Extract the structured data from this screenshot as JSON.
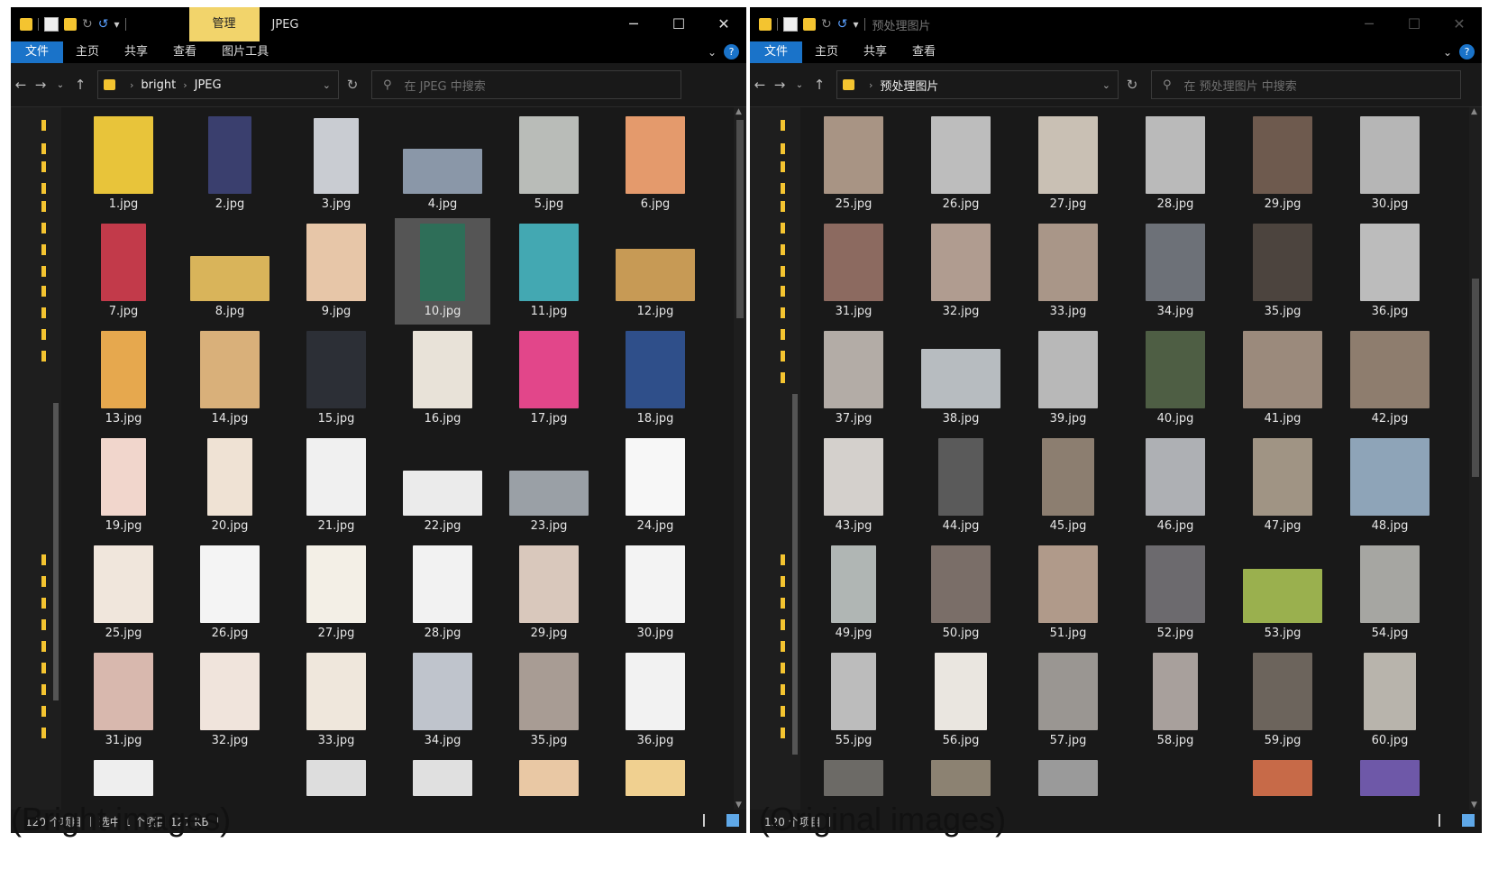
{
  "left_window": {
    "ribbon_context_tab": "管理",
    "title": "JPEG",
    "tabs": [
      "文件",
      "主页",
      "共享",
      "查看",
      "图片工具"
    ],
    "breadcrumb": [
      "bright",
      "JPEG"
    ],
    "search_placeholder": "在 JPEG 中搜索",
    "selected_item": "10.jpg",
    "status": {
      "count": "120 个项目",
      "selection": "选中 1 个项目  127 KB"
    },
    "files": [
      {
        "name": "1.jpg",
        "color": "#e8c43a",
        "w": 66,
        "h": 86
      },
      {
        "name": "2.jpg",
        "color": "#3a3f6e",
        "w": 48,
        "h": 86
      },
      {
        "name": "3.jpg",
        "color": "#c9ccd2",
        "w": 50,
        "h": 84
      },
      {
        "name": "4.jpg",
        "color": "#8a97a8",
        "w": 88,
        "h": 50
      },
      {
        "name": "5.jpg",
        "color": "#b9bcb8",
        "w": 66,
        "h": 86
      },
      {
        "name": "6.jpg",
        "color": "#e49a6c",
        "w": 66,
        "h": 86
      },
      {
        "name": "7.jpg",
        "color": "#c23a4a",
        "w": 50,
        "h": 86
      },
      {
        "name": "8.jpg",
        "color": "#d9b45a",
        "w": 88,
        "h": 50
      },
      {
        "name": "9.jpg",
        "color": "#e7c6a8",
        "w": 66,
        "h": 86
      },
      {
        "name": "10.jpg",
        "color": "#2e6e58",
        "w": 50,
        "h": 86
      },
      {
        "name": "11.jpg",
        "color": "#43a8b2",
        "w": 66,
        "h": 86
      },
      {
        "name": "12.jpg",
        "color": "#c79a55",
        "w": 88,
        "h": 58
      },
      {
        "name": "13.jpg",
        "color": "#e6a84e",
        "w": 50,
        "h": 86
      },
      {
        "name": "14.jpg",
        "color": "#d9b07a",
        "w": 66,
        "h": 86
      },
      {
        "name": "15.jpg",
        "color": "#2c2f36",
        "w": 66,
        "h": 86
      },
      {
        "name": "16.jpg",
        "color": "#e8e2d8",
        "w": 66,
        "h": 86
      },
      {
        "name": "17.jpg",
        "color": "#e2468a",
        "w": 66,
        "h": 86
      },
      {
        "name": "18.jpg",
        "color": "#2f4f8a",
        "w": 66,
        "h": 86
      },
      {
        "name": "19.jpg",
        "color": "#f1d6cc",
        "w": 50,
        "h": 86
      },
      {
        "name": "20.jpg",
        "color": "#efe2d4",
        "w": 50,
        "h": 86
      },
      {
        "name": "21.jpg",
        "color": "#f0f0f0",
        "w": 66,
        "h": 86
      },
      {
        "name": "22.jpg",
        "color": "#ebebeb",
        "w": 88,
        "h": 50
      },
      {
        "name": "23.jpg",
        "color": "#9aa0a6",
        "w": 88,
        "h": 50
      },
      {
        "name": "24.jpg",
        "color": "#f7f7f7",
        "w": 66,
        "h": 86
      },
      {
        "name": "25.jpg",
        "color": "#f0e6dc",
        "w": 66,
        "h": 86
      },
      {
        "name": "26.jpg",
        "color": "#f4f4f4",
        "w": 66,
        "h": 86
      },
      {
        "name": "27.jpg",
        "color": "#f3efe6",
        "w": 66,
        "h": 86
      },
      {
        "name": "28.jpg",
        "color": "#f2f2f2",
        "w": 66,
        "h": 86
      },
      {
        "name": "29.jpg",
        "color": "#d9c8bc",
        "w": 66,
        "h": 86
      },
      {
        "name": "30.jpg",
        "color": "#f3f3f3",
        "w": 66,
        "h": 86
      },
      {
        "name": "31.jpg",
        "color": "#d8b8ae",
        "w": 66,
        "h": 86
      },
      {
        "name": "32.jpg",
        "color": "#f0e4dc",
        "w": 66,
        "h": 86
      },
      {
        "name": "33.jpg",
        "color": "#efe7dc",
        "w": 66,
        "h": 86
      },
      {
        "name": "34.jpg",
        "color": "#bfc4cc",
        "w": 66,
        "h": 86
      },
      {
        "name": "35.jpg",
        "color": "#a89c94",
        "w": 66,
        "h": 86
      },
      {
        "name": "36.jpg",
        "color": "#f2f2f2",
        "w": 66,
        "h": 86
      }
    ],
    "partial_row_colors": [
      "#eeeeee",
      "",
      "#dddddd",
      "#e0e0e0",
      "#e9c8a4",
      "#f0d090"
    ]
  },
  "right_window": {
    "title": "预处理图片",
    "tabs": [
      "文件",
      "主页",
      "共享",
      "查看"
    ],
    "breadcrumb": [
      "预处理图片"
    ],
    "search_placeholder": "在 预处理图片 中搜索",
    "status": {
      "count": "120 个项目"
    },
    "files": [
      {
        "name": "25.jpg",
        "color": "#a89484",
        "w": 66,
        "h": 86
      },
      {
        "name": "26.jpg",
        "color": "#bdbdbd",
        "w": 66,
        "h": 86
      },
      {
        "name": "27.jpg",
        "color": "#c9c0b4",
        "w": 66,
        "h": 86
      },
      {
        "name": "28.jpg",
        "color": "#bababa",
        "w": 66,
        "h": 86
      },
      {
        "name": "29.jpg",
        "color": "#6e5a4e",
        "w": 66,
        "h": 86
      },
      {
        "name": "30.jpg",
        "color": "#b6b6b6",
        "w": 66,
        "h": 86
      },
      {
        "name": "31.jpg",
        "color": "#8c6a60",
        "w": 66,
        "h": 86
      },
      {
        "name": "32.jpg",
        "color": "#b09c90",
        "w": 66,
        "h": 86
      },
      {
        "name": "33.jpg",
        "color": "#a99688",
        "w": 66,
        "h": 86
      },
      {
        "name": "34.jpg",
        "color": "#6d7178",
        "w": 66,
        "h": 86
      },
      {
        "name": "35.jpg",
        "color": "#4c443e",
        "w": 66,
        "h": 86
      },
      {
        "name": "36.jpg",
        "color": "#bcbcbc",
        "w": 66,
        "h": 86
      },
      {
        "name": "37.jpg",
        "color": "#b3aca6",
        "w": 66,
        "h": 86
      },
      {
        "name": "38.jpg",
        "color": "#b7bcc0",
        "w": 88,
        "h": 66
      },
      {
        "name": "39.jpg",
        "color": "#b8b8b8",
        "w": 66,
        "h": 86
      },
      {
        "name": "40.jpg",
        "color": "#4e5e44",
        "w": 66,
        "h": 86
      },
      {
        "name": "41.jpg",
        "color": "#9b8a7c",
        "w": 88,
        "h": 86
      },
      {
        "name": "42.jpg",
        "color": "#8e7d6e",
        "w": 88,
        "h": 86
      },
      {
        "name": "43.jpg",
        "color": "#d4d0cc",
        "w": 66,
        "h": 86
      },
      {
        "name": "44.jpg",
        "color": "#5a5a5a",
        "w": 50,
        "h": 86
      },
      {
        "name": "45.jpg",
        "color": "#8c7e70",
        "w": 58,
        "h": 86
      },
      {
        "name": "46.jpg",
        "color": "#aeb0b4",
        "w": 66,
        "h": 86
      },
      {
        "name": "47.jpg",
        "color": "#a09484",
        "w": 66,
        "h": 86
      },
      {
        "name": "48.jpg",
        "color": "#8ea4b8",
        "w": 88,
        "h": 86
      },
      {
        "name": "49.jpg",
        "color": "#b0b6b4",
        "w": 50,
        "h": 86
      },
      {
        "name": "50.jpg",
        "color": "#7a6e68",
        "w": 66,
        "h": 86
      },
      {
        "name": "51.jpg",
        "color": "#b09a8a",
        "w": 66,
        "h": 86
      },
      {
        "name": "52.jpg",
        "color": "#6c6a6e",
        "w": 66,
        "h": 86
      },
      {
        "name": "53.jpg",
        "color": "#9ab04e",
        "w": 88,
        "h": 60
      },
      {
        "name": "54.jpg",
        "color": "#a6a6a2",
        "w": 66,
        "h": 86
      },
      {
        "name": "55.jpg",
        "color": "#bcbcbc",
        "w": 50,
        "h": 86
      },
      {
        "name": "56.jpg",
        "color": "#eae6e0",
        "w": 58,
        "h": 86
      },
      {
        "name": "57.jpg",
        "color": "#9a9692",
        "w": 66,
        "h": 86
      },
      {
        "name": "58.jpg",
        "color": "#a8a09c",
        "w": 50,
        "h": 86
      },
      {
        "name": "59.jpg",
        "color": "#6c645c",
        "w": 66,
        "h": 86
      },
      {
        "name": "60.jpg",
        "color": "#b8b4ac",
        "w": 58,
        "h": 86
      }
    ],
    "partial_row_colors": [
      "#6c6a66",
      "#8c8272",
      "#9a9a9a",
      "",
      "#c76a48",
      "#6e58a8"
    ]
  },
  "captions": {
    "left": "(Bright images)",
    "right": "(Original images)"
  }
}
